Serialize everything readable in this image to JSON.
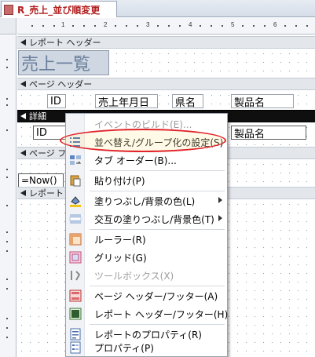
{
  "tab": {
    "label": "R_売上_並び順変更",
    "icon": "report-icon"
  },
  "ruler": {
    "h_numbers": [
      "1",
      "2",
      "3",
      "4",
      "5",
      "6",
      "7"
    ]
  },
  "sections": {
    "report_header": "レポート ヘッダー",
    "page_header": "ページ ヘッダー",
    "detail": "詳細",
    "page_footer": "ページ フ",
    "report_footer": "レポート"
  },
  "controls": {
    "title": "売上一覧",
    "page_header_labels": [
      "ID",
      "売上年月日",
      "県名",
      "製品名"
    ],
    "detail_fields": [
      "ID",
      "製品名"
    ],
    "now": "=Now()"
  },
  "menu": {
    "items": [
      {
        "label": "イベントのビルド(E)...",
        "icon": "build-event-icon",
        "disabled": true
      },
      {
        "label": "並べ替え/グループ化の設定(S)",
        "icon": "sort-group-icon",
        "disabled": false,
        "highlighted": true
      },
      {
        "label": "タブ オーダー(B)...",
        "icon": "tab-order-icon",
        "disabled": false
      },
      {
        "label": "貼り付け(P)",
        "icon": "paste-icon",
        "disabled": false
      },
      {
        "label": "塗りつぶし/背景の色(L)",
        "icon": "fill-color-icon",
        "disabled": false,
        "submenu": true
      },
      {
        "label": "交互の塗りつぶし/背景色(T)",
        "icon": "alternate-fill-icon",
        "disabled": false,
        "submenu": true
      },
      {
        "label": "ルーラー(R)",
        "icon": "ruler-icon",
        "disabled": false
      },
      {
        "label": "グリッド(G)",
        "icon": "grid-icon",
        "disabled": false
      },
      {
        "label": "ツールボックス(X)",
        "icon": "toolbox-icon",
        "disabled": true
      },
      {
        "label": "ページ ヘッダー/フッター(A)",
        "icon": "page-header-footer-icon",
        "disabled": false
      },
      {
        "label": "レポート ヘッダー/フッター(H)",
        "icon": "report-header-footer-icon",
        "disabled": false
      },
      {
        "label": "レポートのプロパティ(R)",
        "icon": "report-properties-icon",
        "disabled": false
      },
      {
        "label": "プロパティ(P)",
        "icon": "properties-icon",
        "disabled": false
      }
    ]
  },
  "colors": {
    "highlight": "#e0242a",
    "tab_text": "#b21f1f"
  }
}
